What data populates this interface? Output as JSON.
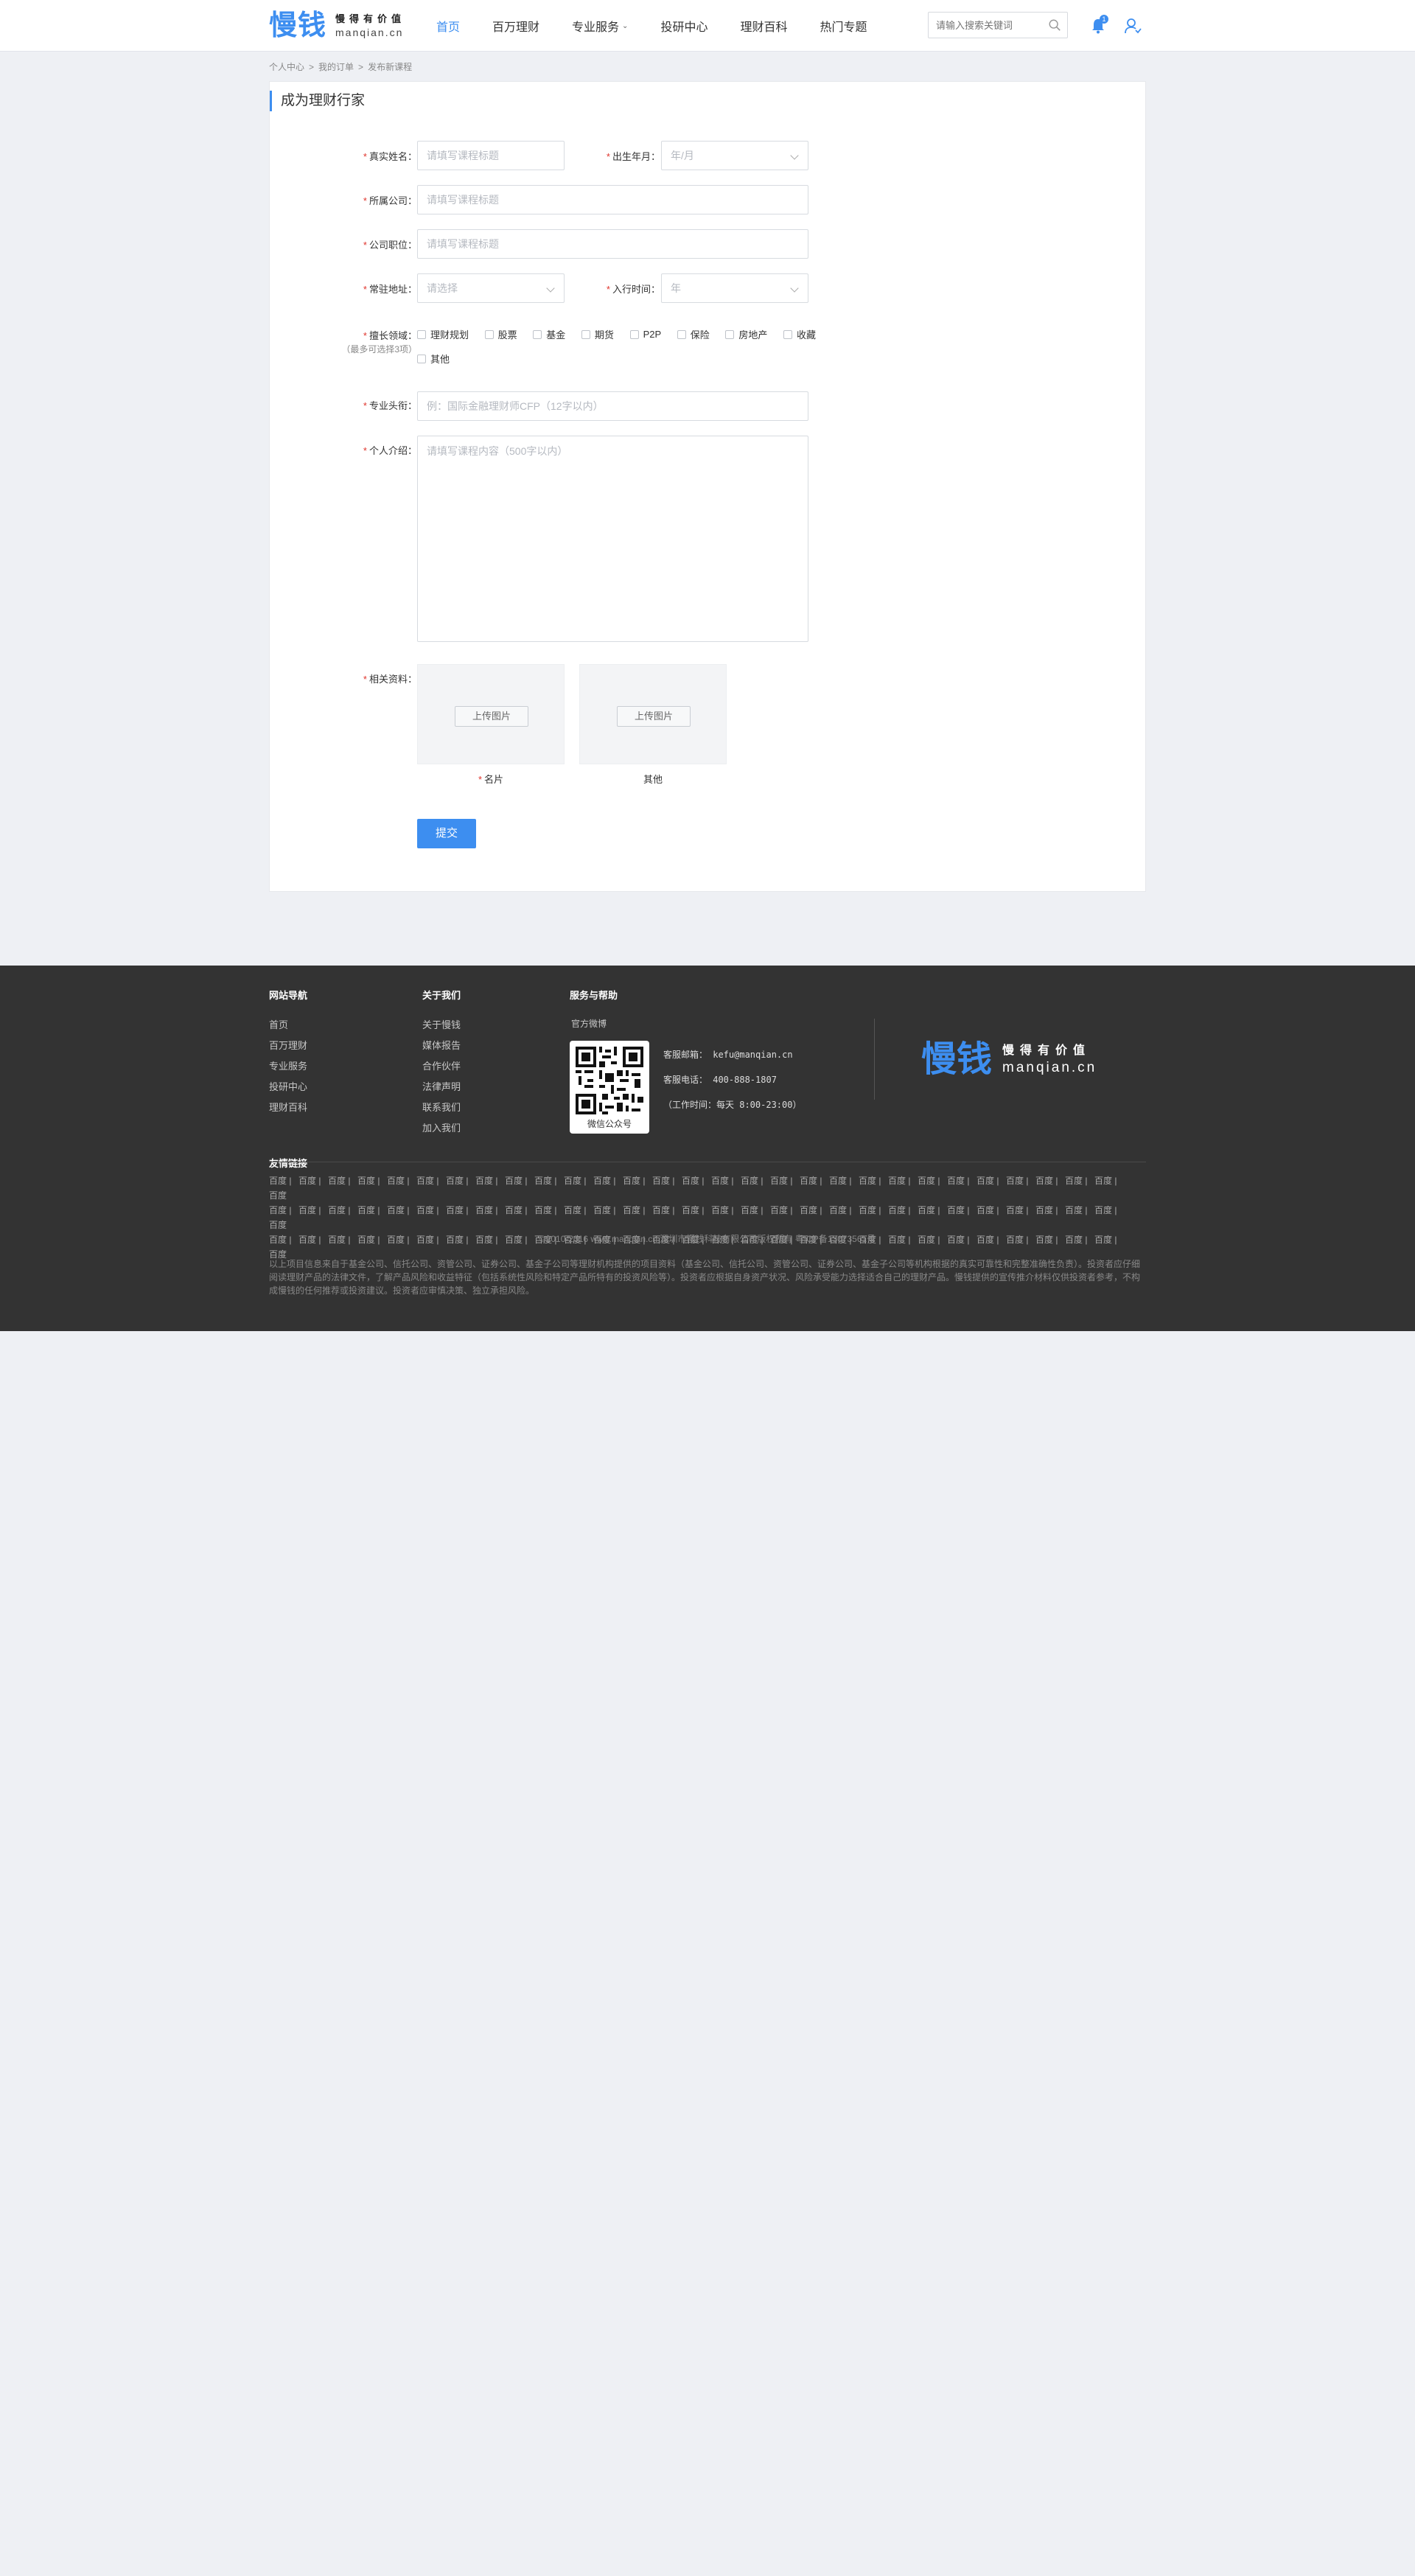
{
  "header": {
    "logo_mark": "慢钱",
    "logo_slogan": "慢得有价值",
    "logo_domain": "manqian.cn",
    "nav": [
      {
        "label": "首页",
        "active": true
      },
      {
        "label": "百万理财"
      },
      {
        "label": "专业服务",
        "has_dropdown": true
      },
      {
        "label": "投研中心"
      },
      {
        "label": "理财百科"
      },
      {
        "label": "热门专题"
      }
    ],
    "search_placeholder": "请输入搜索关键词",
    "notification_count": "1"
  },
  "breadcrumb": [
    "个人中心",
    "我的订单",
    "发布新课程"
  ],
  "form": {
    "title": "成为理财行家",
    "real_name_label": "真实姓名：",
    "real_name_placeholder": "请填写课程标题",
    "birth_label": "出生年月：",
    "birth_placeholder": "年/月",
    "company_label": "所属公司：",
    "company_placeholder": "请填写课程标题",
    "position_label": "公司职位：",
    "position_placeholder": "请填写课程标题",
    "address_label": "常驻地址：",
    "address_placeholder": "请选择",
    "industry_time_label": "入行时间：",
    "industry_time_placeholder": "年",
    "specialty_label": "擅长领域：",
    "specialty_note": "（最多可选择3项）",
    "specialties": [
      "理财规划",
      "股票",
      "基金",
      "期货",
      "P2P",
      "保险",
      "房地产",
      "收藏",
      "其他"
    ],
    "title_field_label": "专业头衔：",
    "title_field_placeholder": "例：国际金融理财师CFP（12字以内）",
    "intro_label": "个人介绍：",
    "intro_placeholder": "请填写课程内容（500字以内）",
    "materials_label": "相关资料：",
    "upload_button": "上传图片",
    "upload_caption_1": "名片",
    "upload_caption_2": "其他",
    "submit": "提交"
  },
  "footer": {
    "nav_title": "网站导航",
    "nav_links": [
      "首页",
      "百万理财",
      "专业服务",
      "投研中心",
      "理财百科"
    ],
    "about_title": "关于我们",
    "about_links": [
      "关于慢钱",
      "媒体报告",
      "合作伙伴",
      "法律声明",
      "联系我们",
      "加入我们"
    ],
    "service_title": "服务与帮助",
    "wechat_label": "官方微博",
    "qr_caption": "微信公众号",
    "email": "客服邮箱：  kefu@manqian.cn",
    "phone": "客服电话：  400-888-1807",
    "hours": "（工作时间：每天 8:00-23:00）",
    "logo_mark": "慢钱",
    "logo_slogan": "慢得有价值",
    "logo_domain": "manqian.cn",
    "friend_links_title": "友情链接",
    "friend_link_text": "百度",
    "copyright": "©2010-2016 www.manqian.cn 深圳市慢钱科技有限公司版权所有    粤ICP备13073561号",
    "disclaimer": "以上项目信息来自于基金公司、信托公司、资管公司、证券公司、基金子公司等理财机构提供的项目资料（基金公司、信托公司、资管公司、证券公司、基金子公司等机构根据的真实可靠性和完整准确性负责）。投资者应仔细阅读理财产品的法律文件，了解产品风险和收益特征（包括系统性风险和特定产品所特有的投资风险等）。投资者应根据自身资产状况、风险承受能力选择适合自己的理财产品。慢钱提供的宣传推介材料仅供投资者参考，不构成慢钱的任何推荐或投资建议。投资者应审慎决策、独立承担风险。"
  },
  "colors": {
    "accent": "#3d8ef0",
    "required": "#e0342c",
    "footer_bg": "#333333"
  }
}
